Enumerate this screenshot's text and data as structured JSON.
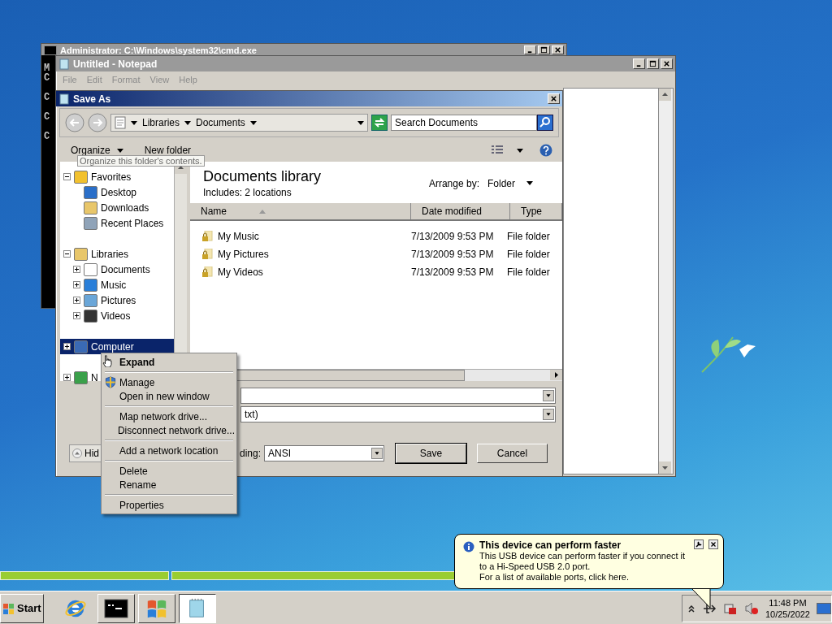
{
  "cmd_window": {
    "title": "Administrator: C:\\Windows\\system32\\cmd.exe",
    "paragraphs": [
      [
        "M",
        "C"
      ],
      [
        "C"
      ],
      [
        "C"
      ],
      [
        "C"
      ]
    ]
  },
  "notepad": {
    "title": "Untitled - Notepad",
    "menu": [
      "File",
      "Edit",
      "Format",
      "View",
      "Help"
    ]
  },
  "save_as": {
    "title": "Save As",
    "breadcrumb": [
      "Libraries",
      "Documents"
    ],
    "search_placeholder": "Search Documents",
    "toolbar": {
      "organize": "Organize",
      "new_folder": "New folder"
    },
    "tooltip": "Organize this folder's contents.",
    "nav": [
      {
        "label": "Favorites",
        "kind": "star",
        "expanded": true,
        "selected": false,
        "children": [
          {
            "label": "Desktop",
            "kind": "desktop",
            "selected": false
          },
          {
            "label": "Downloads",
            "kind": "downloads",
            "selected": false
          },
          {
            "label": "Recent Places",
            "kind": "recent",
            "selected": false
          }
        ]
      },
      {
        "label": "Libraries",
        "kind": "library",
        "expanded": true,
        "selected": false,
        "children": [
          {
            "label": "Documents",
            "kind": "document",
            "expanded": false,
            "selected": false
          },
          {
            "label": "Music",
            "kind": "music",
            "expanded": false,
            "selected": false
          },
          {
            "label": "Pictures",
            "kind": "picture",
            "expanded": false,
            "selected": false
          },
          {
            "label": "Videos",
            "kind": "video",
            "expanded": false,
            "selected": false
          }
        ]
      },
      {
        "label": "Computer",
        "kind": "computer",
        "expanded": false,
        "selected": true
      },
      {
        "label": "N",
        "kind": "network",
        "expanded": false,
        "selected": false
      }
    ],
    "library": {
      "title": "Documents library",
      "includes": "Includes:  2 locations",
      "arrange_label": "Arrange by:",
      "arrange_value": "Folder"
    },
    "columns": [
      {
        "label": "Name",
        "sorted": true
      },
      {
        "label": "Date modified",
        "sorted": false
      },
      {
        "label": "Type",
        "sorted": false
      }
    ],
    "rows": [
      {
        "name": "My Music",
        "date": "7/13/2009 9:53 PM",
        "type": "File folder",
        "selected": false
      },
      {
        "name": "My Pictures",
        "date": "7/13/2009 9:53 PM",
        "type": "File folder",
        "selected": false
      },
      {
        "name": "My Videos",
        "date": "7/13/2009 9:53 PM",
        "type": "File folder",
        "selected": false
      }
    ],
    "file_type": "txt)",
    "encoding_label": "ding:",
    "encoding": "ANSI",
    "save": "Save",
    "cancel": "Cancel",
    "hide_button": "Hid"
  },
  "context_menu": [
    [
      {
        "label": "Expand",
        "kind": "default"
      }
    ],
    [
      {
        "label": "Manage",
        "kind": "shield"
      },
      {
        "label": "Open in new window",
        "kind": "plain"
      }
    ],
    [
      {
        "label": "Map network drive...",
        "kind": "plain"
      },
      {
        "label": "Disconnect network drive...",
        "kind": "plain"
      }
    ],
    [
      {
        "label": "Add a network location",
        "kind": "plain"
      }
    ],
    [
      {
        "label": "Delete",
        "kind": "plain"
      },
      {
        "label": "Rename",
        "kind": "plain"
      }
    ],
    [
      {
        "label": "Properties",
        "kind": "plain"
      }
    ]
  ],
  "balloon": {
    "title": "This device can perform faster",
    "text": "This USB device can perform faster if you connect it to a Hi-Speed USB 2.0 port.",
    "link": "For a list of available ports, click here."
  },
  "taskbar": {
    "start": "Start",
    "apps": [
      {
        "kind": "ie",
        "selected": false
      },
      {
        "kind": "cmd",
        "selected": false
      },
      {
        "kind": "windows",
        "selected": false
      },
      {
        "kind": "notepad",
        "selected": true
      }
    ],
    "time": "11:48 PM",
    "date": "10/25/2022"
  }
}
